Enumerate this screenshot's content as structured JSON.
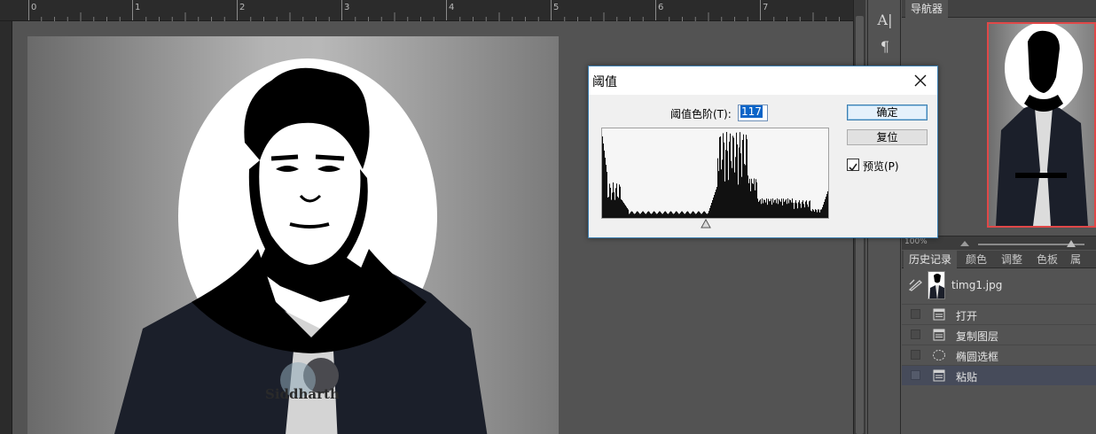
{
  "ruler": {
    "labels": [
      "0",
      "1",
      "2",
      "3",
      "4",
      "5",
      "6",
      "7"
    ]
  },
  "tools": {
    "char_icon": "A|",
    "para_icon": "¶"
  },
  "navigator": {
    "tab_label": "导航器",
    "zoom": "100%"
  },
  "panel_tabs": [
    "历史记录",
    "颜色",
    "调整",
    "色板",
    "属性"
  ],
  "history": {
    "snapshot_label": "timg1.jpg",
    "items": [
      {
        "label": "打开",
        "icon": "document-icon"
      },
      {
        "label": "复制图层",
        "icon": "document-icon"
      },
      {
        "label": "椭圆选框",
        "icon": "ellipse-marquee-icon"
      },
      {
        "label": "粘贴",
        "icon": "document-icon",
        "selected": true
      }
    ]
  },
  "dialog": {
    "title": "阈值",
    "level_label": "阈值色阶(T):",
    "level_value": "117",
    "ok_label": "确定",
    "reset_label": "复位",
    "preview_label": "预览(P)",
    "preview_checked": true
  },
  "artwork": {
    "shirt_text": "Siddharth"
  },
  "colors": {
    "accent_selection": "#0a64c8",
    "navigator_frame": "#e04848",
    "dialog_border": "#3c7fb1"
  }
}
